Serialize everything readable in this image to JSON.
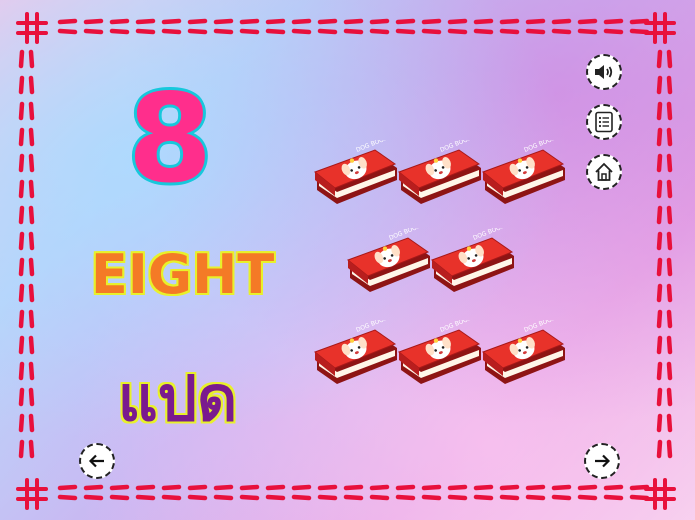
{
  "lesson": {
    "numeral": "8",
    "word_english": "EIGHT",
    "word_thai": "แปด",
    "count": 8
  },
  "book": {
    "title": "DOG BOOK",
    "cover_color": "#e8322a"
  },
  "controls": {
    "sound_icon": "speaker-icon",
    "menu_icon": "list-icon",
    "home_icon": "home-icon",
    "prev_icon": "arrow-left-icon",
    "next_icon": "arrow-right-icon"
  },
  "colors": {
    "frame": "#e8103c",
    "numeral": "#ff2e8c",
    "numeral_outline": "#17c8dc",
    "word_english": "#f47a26",
    "word_thai": "#7a1a8e",
    "outline": "#e8f12a"
  }
}
